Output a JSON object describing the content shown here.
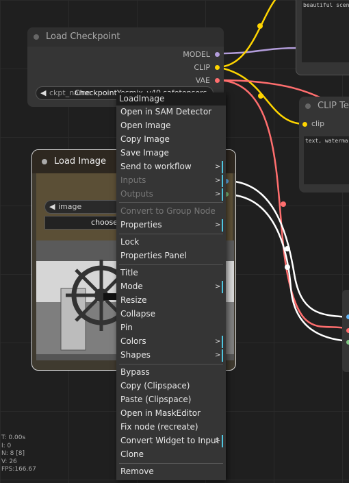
{
  "canvas": {
    "background": "#1f1f1f"
  },
  "nodes": {
    "load_checkpoint": {
      "title": "Load Checkpoint",
      "outputs": [
        "MODEL",
        "CLIP",
        "VAE"
      ],
      "widget_name": "ckpt_name",
      "widget_value": "CheckpointYesmix_v40.safetensors"
    },
    "load_image": {
      "title": "Load Image",
      "widget_name": "image",
      "widget_value": "choose"
    },
    "clip_text": {
      "title": "CLIP Te",
      "input": "clip",
      "text": "text, watermar"
    },
    "top_text": {
      "text": "beautiful scene"
    }
  },
  "stats": {
    "t": "T: 0.00s",
    "i": "I: 0",
    "n": "N: 8 [8]",
    "v": "V: 26",
    "fps": "FPS:166.67"
  },
  "context_menu": {
    "title": "LoadImage",
    "items": [
      {
        "label": "Open in SAM Detector"
      },
      {
        "label": "Open Image"
      },
      {
        "label": "Copy Image"
      },
      {
        "label": "Save Image"
      },
      {
        "label": "Send to workflow",
        "submenu": true
      },
      {
        "label": "Inputs",
        "submenu": true,
        "disabled": true
      },
      {
        "label": "Outputs",
        "submenu": true,
        "disabled": true
      },
      {
        "label": "Convert to Group Node",
        "disabled": true
      },
      {
        "label": "Properties",
        "submenu": true
      },
      {
        "label": "Lock"
      },
      {
        "label": "Properties Panel"
      },
      {
        "label": "Title"
      },
      {
        "label": "Mode",
        "submenu": true
      },
      {
        "label": "Resize"
      },
      {
        "label": "Collapse"
      },
      {
        "label": "Pin"
      },
      {
        "label": "Colors",
        "submenu": true
      },
      {
        "label": "Shapes",
        "submenu": true
      },
      {
        "label": "Bypass"
      },
      {
        "label": "Copy (Clipspace)"
      },
      {
        "label": "Paste (Clipspace)"
      },
      {
        "label": "Open in MaskEditor"
      },
      {
        "label": "Fix node (recreate)"
      },
      {
        "label": "Convert Widget to Input",
        "submenu": true
      },
      {
        "label": "Clone"
      },
      {
        "label": "Remove"
      }
    ]
  },
  "colors": {
    "model_link": "#b39ddb",
    "clip_link": "#ffd500",
    "vae_link": "#ff6e6e",
    "image_link": "#ffffff",
    "submenu_accent": "#4fc6e0"
  }
}
